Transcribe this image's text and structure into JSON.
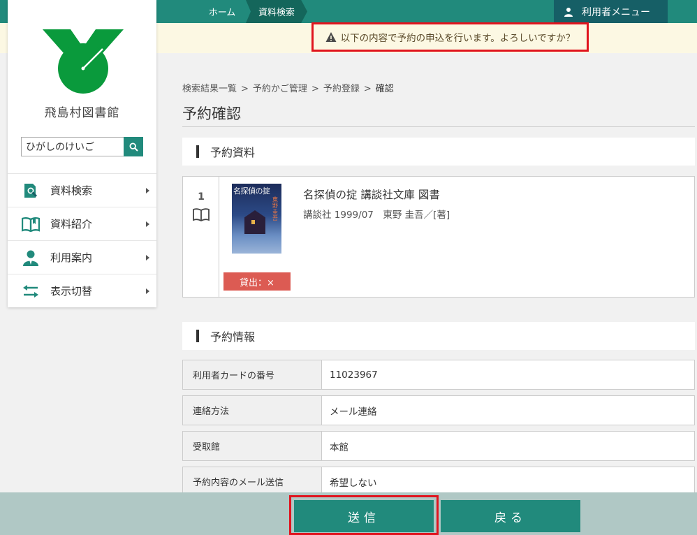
{
  "topbar": {
    "home": "ホーム",
    "current": "資料検索",
    "user_menu": "利用者メニュー"
  },
  "alert": {
    "message": "以下の内容で予約の申込を行います。よろしいですか？"
  },
  "sidebar": {
    "library_name": "飛島村図書館",
    "search_value": "ひがしのけいご",
    "items": [
      {
        "label": "資料検索"
      },
      {
        "label": "資料紹介"
      },
      {
        "label": "利用案内"
      },
      {
        "label": "表示切替"
      }
    ]
  },
  "breadcrumb": {
    "items": [
      "検索結果一覧",
      "予約かご管理",
      "予約登録"
    ],
    "current": "確認",
    "separator": ">"
  },
  "page": {
    "title": "予約確認"
  },
  "materials": {
    "heading": "予約資料",
    "item": {
      "number": "1",
      "title": "名探偵の掟 講談社文庫 図書",
      "meta": "講談社 1999/07　東野 圭吾／[著]",
      "cover_title": "名探偵の掟",
      "cover_author": "東野圭吾",
      "loan_status": "貸出：×"
    }
  },
  "reservation": {
    "heading": "予約情報",
    "rows": [
      {
        "label": "利用者カードの番号",
        "value": "11023967"
      },
      {
        "label": "連絡方法",
        "value": "メール連絡"
      },
      {
        "label": "受取館",
        "value": "本館"
      },
      {
        "label": "予約内容のメール送信",
        "value": "希望しない"
      }
    ]
  },
  "actions": {
    "send": "送信",
    "back": "戻る"
  },
  "colors": {
    "accent": "#218a7c",
    "logo_green": "#0a9a3c",
    "alert_border": "#e0141e",
    "loan_badge": "#dc5b53"
  }
}
